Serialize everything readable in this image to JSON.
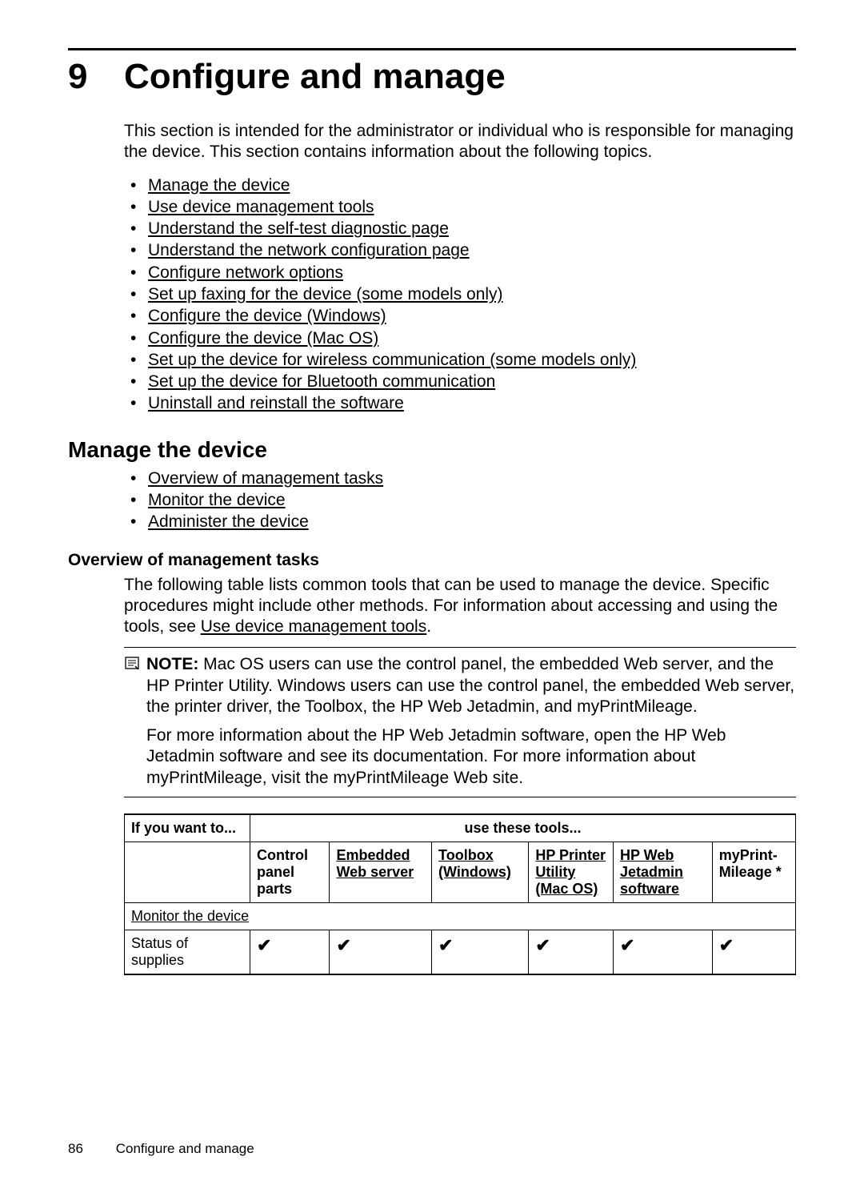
{
  "chapter": {
    "number": "9",
    "title": "Configure and manage"
  },
  "intro": "This section is intended for the administrator or individual who is responsible for managing the device. This section contains information about the following topics.",
  "topics": [
    "Manage the device",
    "Use device management tools",
    "Understand the self-test diagnostic page",
    "Understand the network configuration page",
    "Configure network options",
    "Set up faxing for the device (some models only)",
    "Configure the device (Windows)",
    "Configure the device (Mac OS)",
    "Set up the device for wireless communication (some models only)",
    "Set up the device for Bluetooth communication",
    "Uninstall and reinstall the software"
  ],
  "manage_section": {
    "title": "Manage the device",
    "subtopics": [
      "Overview of management tasks",
      "Monitor the device",
      "Administer the device"
    ]
  },
  "overview": {
    "title": "Overview of management tasks",
    "para_before_link": "The following table lists common tools that can be used to manage the device. Specific procedures might include other methods. For information about accessing and using the tools, see ",
    "para_link": "Use device management tools",
    "para_after_link": "."
  },
  "note": {
    "label": "NOTE:",
    "body": "  Mac OS users can use the control panel, the embedded Web server, and the HP Printer Utility. Windows users can use the control panel, the embedded Web server, the printer driver, the Toolbox, the HP Web Jetadmin, and myPrintMileage.",
    "body2": "For more information about the HP Web Jetadmin software, open the HP Web Jetadmin software and see its documentation. For more information about myPrintMileage, visit the myPrintMileage Web site."
  },
  "table": {
    "header_left": "If you want to...",
    "header_right": "use these tools...",
    "columns": [
      {
        "text": "Control panel parts",
        "link": false
      },
      {
        "text": "Embedded Web server",
        "link": true
      },
      {
        "text": "Toolbox (Windows)",
        "link": true
      },
      {
        "text": "HP Printer Utility (Mac OS)",
        "link": true
      },
      {
        "text": "HP Web Jetadmin software",
        "link": true
      },
      {
        "text": "myPrint-Mileage *",
        "link": false
      }
    ],
    "section_row": "Monitor the device",
    "data_row": {
      "label": "Status of supplies",
      "checks": [
        true,
        true,
        true,
        true,
        true,
        true
      ]
    }
  },
  "footer": {
    "page": "86",
    "title": "Configure and manage"
  }
}
